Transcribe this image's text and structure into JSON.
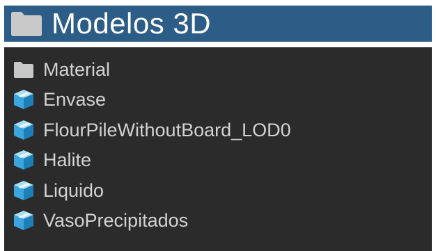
{
  "header": {
    "title": "Modelos 3D",
    "icon": "folder-icon",
    "background_color": "#2c5d87"
  },
  "list": {
    "background_color": "#2b2b2b",
    "items": [
      {
        "label": "Material",
        "icon": "folder-icon"
      },
      {
        "label": "Envase",
        "icon": "model-prefab-icon"
      },
      {
        "label": "FlourPileWithoutBoard_LOD0",
        "icon": "model-prefab-icon"
      },
      {
        "label": "Halite",
        "icon": "model-prefab-icon"
      },
      {
        "label": "Liquido",
        "icon": "model-prefab-icon"
      },
      {
        "label": "VasoPrecipitados",
        "icon": "model-prefab-icon"
      }
    ]
  }
}
